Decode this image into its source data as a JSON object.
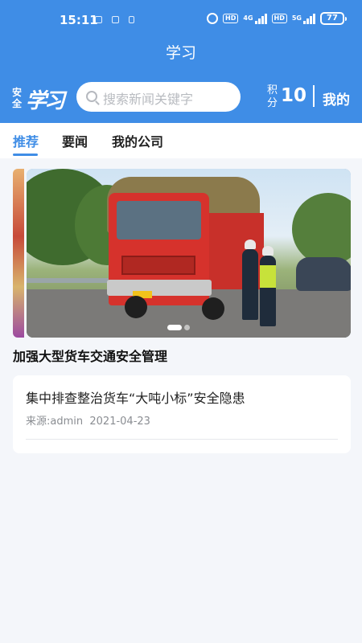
{
  "status_bar": {
    "time": "15:11",
    "network_badges": [
      "HD",
      "4G",
      "HD",
      "5G"
    ],
    "battery": "77"
  },
  "header": {
    "title": "学习",
    "logo": {
      "small": "安全",
      "big": "学习"
    },
    "search": {
      "placeholder": "搜索新闻关键字"
    },
    "points_label": "积分",
    "points_value": "10",
    "mine_label": "我的"
  },
  "tabs": [
    {
      "label": "推荐",
      "active": true
    },
    {
      "label": "要闻",
      "active": false
    },
    {
      "label": "我的公司",
      "active": false
    }
  ],
  "banner": {
    "caption": "加强大型货车交通安全管理",
    "slide_count": 2,
    "active_slide": 1
  },
  "news": [
    {
      "title": "集中排查整治货车“大吨小标”安全隐患",
      "source_label": "来源:",
      "source": "admin",
      "date": "2021-04-23"
    }
  ],
  "colors": {
    "brand": "#3f8de6",
    "background": "#f4f6fa"
  },
  "icons": [
    "alarm-icon",
    "signal-icon",
    "battery-icon",
    "search-icon"
  ]
}
